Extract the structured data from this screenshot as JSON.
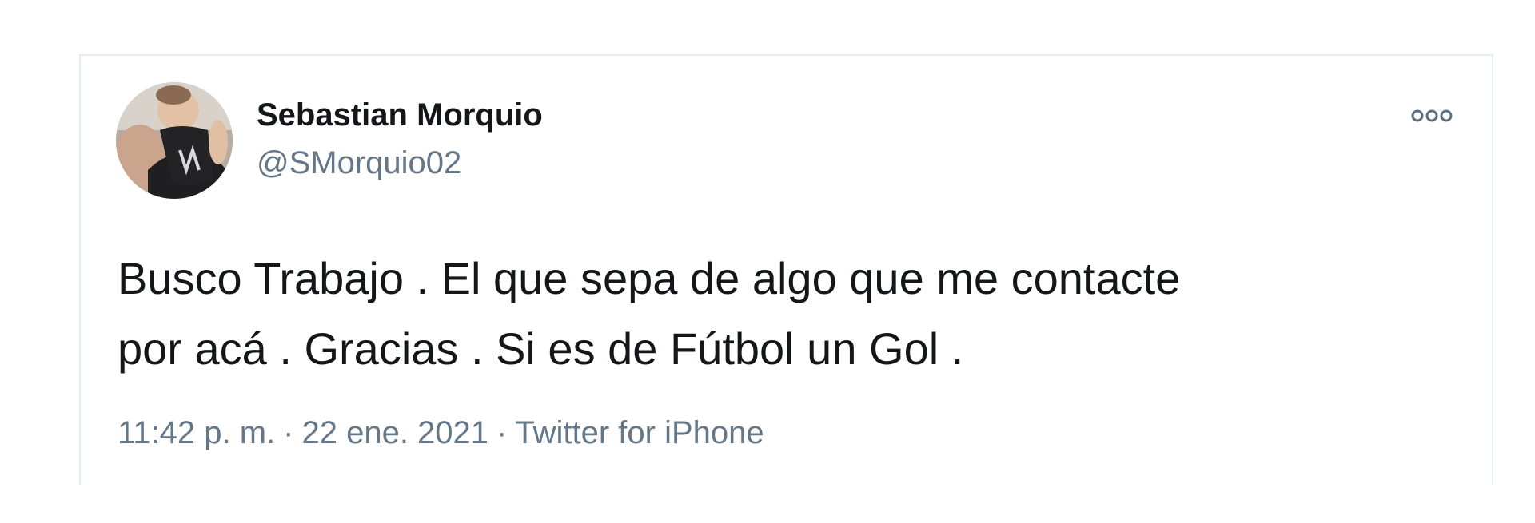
{
  "tweet": {
    "author": {
      "name": "Sebastian Morquio",
      "handle": "@SMorquio02",
      "avatar_icon": "profile-photo"
    },
    "more_icon": "more-options-icon",
    "text_lines": [
      "Busco Trabajo . El que sepa de algo que me contacte",
      "por acá . Gracias . Si es de Fútbol un Gol ."
    ],
    "time": "11:42 p. m.",
    "separator": "·",
    "date": "22 ene. 2021",
    "source": "Twitter for iPhone"
  },
  "colors": {
    "text": "#14171a",
    "secondary": "#657786",
    "border": "#e6ecf0",
    "icon": "#5b7083"
  }
}
